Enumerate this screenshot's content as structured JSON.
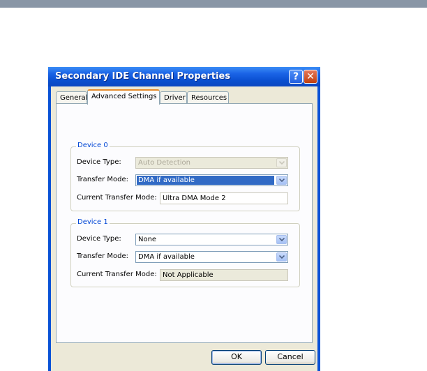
{
  "window": {
    "title": "Secondary IDE Channel Properties"
  },
  "title_buttons": {
    "help": "?",
    "close": "✕"
  },
  "tabs": [
    {
      "label": "General"
    },
    {
      "label": "Advanced Settings"
    },
    {
      "label": "Driver"
    },
    {
      "label": "Resources"
    }
  ],
  "active_tab": "Advanced Settings",
  "device0": {
    "title": "Device 0",
    "device_type_label": "Device Type:",
    "device_type_value": "Auto Detection",
    "transfer_mode_label": "Transfer Mode:",
    "transfer_mode_value": "DMA if available",
    "current_mode_label": "Current Transfer Mode:",
    "current_mode_value": "Ultra DMA Mode 2"
  },
  "device1": {
    "title": "Device 1",
    "device_type_label": "Device Type:",
    "device_type_value": "None",
    "transfer_mode_label": "Transfer Mode:",
    "transfer_mode_value": "DMA if available",
    "current_mode_label": "Current Transfer Mode:",
    "current_mode_value": "Not Applicable"
  },
  "buttons": {
    "ok": "OK",
    "cancel": "Cancel"
  },
  "colors": {
    "title_bar": "#0a52d6",
    "group_title": "#0046d5",
    "selection": "#316ac5",
    "active_tab_accent": "#e68b2c"
  }
}
